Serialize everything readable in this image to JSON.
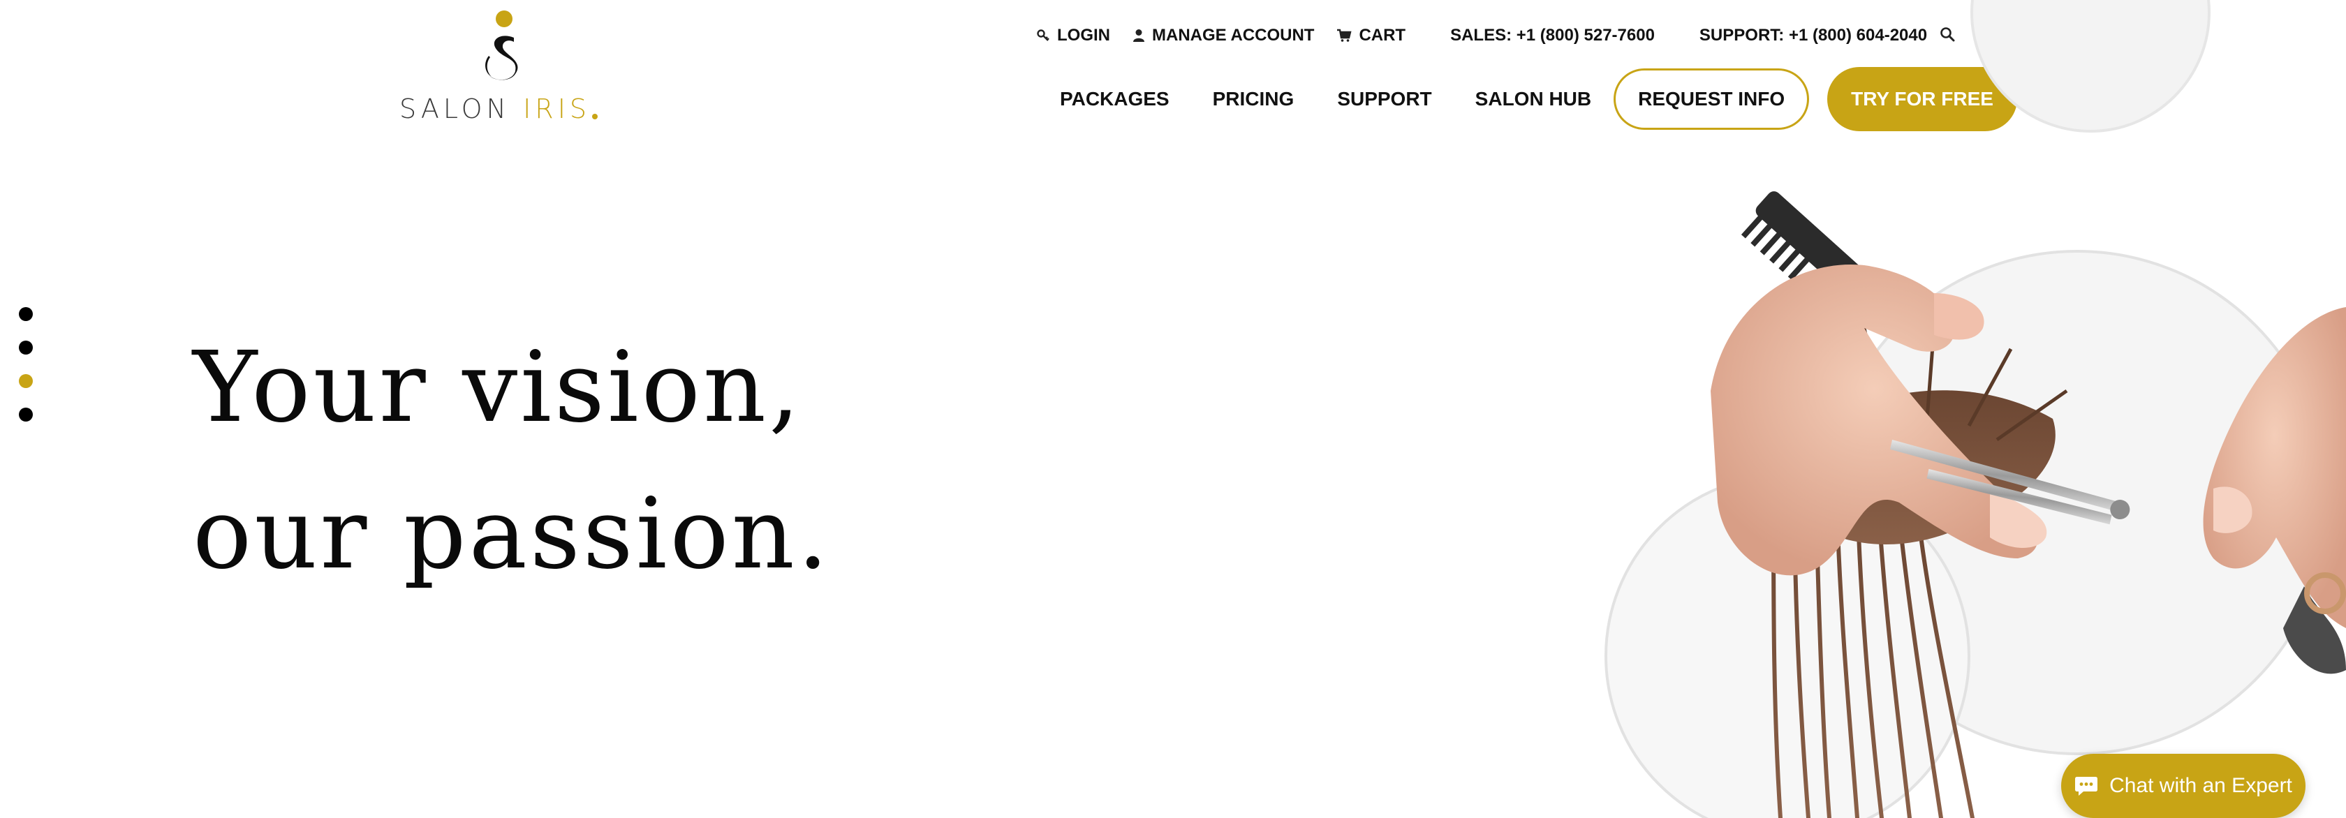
{
  "brand": {
    "name_part1": "SALON",
    "name_part2": "IRIS",
    "accent_color": "#c8a415"
  },
  "utility_nav": {
    "login": "LOGIN",
    "manage_account": "MANAGE ACCOUNT",
    "cart": "CART",
    "sales": "SALES: +1 (800) 527-7600",
    "support": "SUPPORT: +1 (800) 604-2040"
  },
  "main_nav": {
    "packages": "PACKAGES",
    "pricing": "PRICING",
    "support": "SUPPORT",
    "salon_hub": "SALON HUB",
    "request_info": "REQUEST INFO",
    "try_free": "TRY FOR FREE"
  },
  "hero": {
    "line1": "Your vision,",
    "line2": "our passion.",
    "slides": 4,
    "active_slide": 3
  },
  "chat": {
    "label": "Chat with an Expert"
  },
  "icons": {
    "login": "key-icon",
    "manage_account": "user-icon",
    "cart": "cart-icon",
    "search": "search-icon",
    "chat": "chat-bubble-icon"
  }
}
